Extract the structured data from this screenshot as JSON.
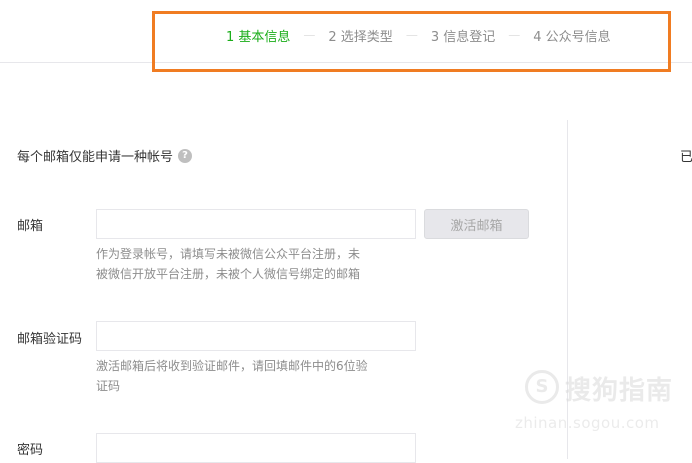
{
  "steps": [
    {
      "label": "1 基本信息"
    },
    {
      "label": "2 选择类型"
    },
    {
      "label": "3 信息登记"
    },
    {
      "label": "4 公众号信息"
    }
  ],
  "step_separator": "—",
  "colors": {
    "active_step": "#1aad19",
    "highlight_box": "#f07c22",
    "hint_text": "#8d8d8d"
  },
  "tip": {
    "text": "每个邮箱仅能申请一种帐号",
    "icon": "?"
  },
  "side_text": "已",
  "form": {
    "email": {
      "label": "邮箱",
      "value": "",
      "button_label": "激活邮箱",
      "hint_line1": "作为登录帐号，请填写未被微信公众平台注册，未",
      "hint_line2": "被微信开放平台注册，未被个人微信号绑定的邮箱"
    },
    "code": {
      "label": "邮箱验证码",
      "value": "",
      "hint_line1": "激活邮箱后将收到验证邮件，请回填邮件中的6位验",
      "hint_line2": "证码"
    },
    "password": {
      "label": "密码",
      "value": ""
    }
  },
  "watermark": {
    "logo": "S",
    "title": "搜狗指南",
    "url": "zhinan.sogou.com"
  }
}
